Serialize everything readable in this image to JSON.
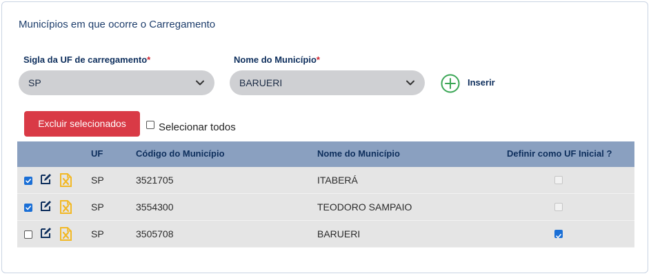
{
  "section_title": "Municípios em que ocorre o Carregamento",
  "uf_field": {
    "label": "Sigla da UF de carregamento",
    "required_mark": "*",
    "value": "SP"
  },
  "municipio_field": {
    "label": "Nome do Município",
    "required_mark": "*",
    "value": "BARUERI"
  },
  "insert_label": "Inserir",
  "delete_selected_label": "Excluir selecionados",
  "select_all_label": "Selecionar todos",
  "table": {
    "headers": {
      "uf": "UF",
      "codigo": "Código do Município",
      "nome": "Nome do Município",
      "inicial": "Definir como UF Inicial ?"
    },
    "rows": [
      {
        "selected": true,
        "uf": "SP",
        "codigo": "3521705",
        "nome": "ITABERÁ",
        "uf_inicial": false
      },
      {
        "selected": true,
        "uf": "SP",
        "codigo": "3554300",
        "nome": "TEODORO SAMPAIO",
        "uf_inicial": false
      },
      {
        "selected": false,
        "uf": "SP",
        "codigo": "3505708",
        "nome": "BARUERI",
        "uf_inicial": true
      }
    ]
  },
  "colors": {
    "header_bg": "#8aa0c0",
    "danger": "#d93a46",
    "add_green": "#3aa655",
    "icon_navy": "#0d2e5c",
    "icon_yellow": "#f2b824",
    "check_blue": "#1a6fd6"
  },
  "icons": {
    "add": "plus-circle-icon",
    "edit": "pencil-square-icon",
    "delete": "document-x-icon",
    "dropdown": "chevron-down-icon"
  }
}
